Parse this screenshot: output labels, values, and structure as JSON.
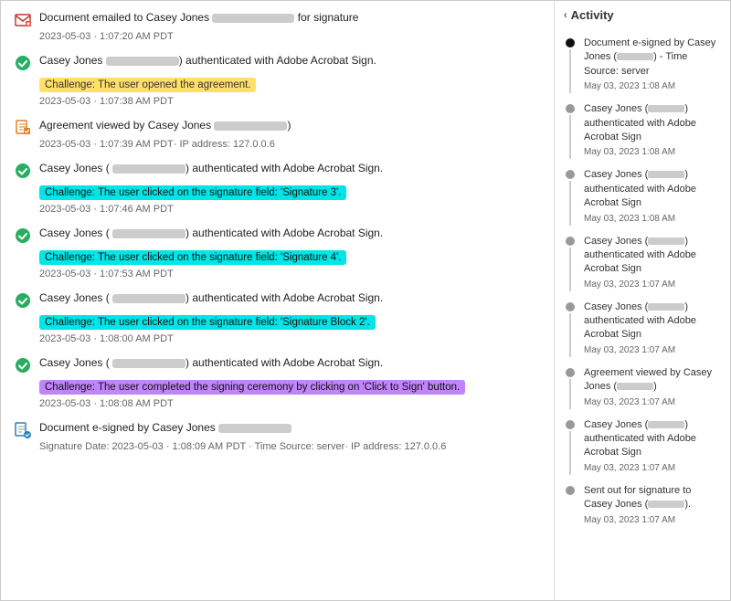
{
  "leftPanel": {
    "events": [
      {
        "id": "email-sent",
        "iconType": "email",
        "iconSymbol": "✉",
        "text": "Document emailed to Casey Jones",
        "blurWidth": "90px",
        "textSuffix": " for signature",
        "timestamp": "2023-05-03 · 1:07:20 AM PDT",
        "challenge": null
      },
      {
        "id": "auth-1",
        "iconType": "check",
        "iconSymbol": "✔",
        "text": "Casey Jones",
        "blurWidth": "80px",
        "textSuffix": ") authenticated with Adobe Acrobat Sign.",
        "timestamp": "2023-05-03 · 1:07:38 AM PDT",
        "challenge": "Challenge: The user opened the agreement.",
        "challengeColor": "badge-yellow"
      },
      {
        "id": "view-1",
        "iconType": "view",
        "iconSymbol": "📄",
        "text": "Agreement viewed by Casey Jones",
        "blurWidth": "80px",
        "textSuffix": ")",
        "timestamp": "2023-05-03 · 1:07:39 AM PDT· IP address: 127.0.0.6",
        "challenge": null
      },
      {
        "id": "auth-2",
        "iconType": "check",
        "iconSymbol": "✔",
        "text": "Casey Jones (",
        "blurWidth": "80px",
        "textSuffix": ") authenticated with Adobe Acrobat Sign.",
        "timestamp": "2023-05-03 · 1:07:46 AM PDT",
        "challenge": "Challenge: The user clicked on the signature field: 'Signature 3'.",
        "challengeColor": "badge-cyan"
      },
      {
        "id": "auth-3",
        "iconType": "check",
        "iconSymbol": "✔",
        "text": "Casey Jones (",
        "blurWidth": "80px",
        "textSuffix": ") authenticated with Adobe Acrobat Sign.",
        "timestamp": "2023-05-03 · 1:07:53 AM PDT",
        "challenge": "Challenge: The user clicked on the signature field: 'Signature 4'.",
        "challengeColor": "badge-cyan"
      },
      {
        "id": "auth-4",
        "iconType": "check",
        "iconSymbol": "✔",
        "text": "Casey Jones (",
        "blurWidth": "80px",
        "textSuffix": ") authenticated with Adobe Acrobat Sign.",
        "timestamp": "2023-05-03 · 1:08:00 AM PDT",
        "challenge": "Challenge: The user clicked on the signature field: 'Signature Block 2'.",
        "challengeColor": "badge-cyan"
      },
      {
        "id": "auth-5",
        "iconType": "check",
        "iconSymbol": "✔",
        "text": "Casey Jones (",
        "blurWidth": "80px",
        "textSuffix": ") authenticated with Adobe Acrobat Sign.",
        "timestamp": "2023-05-03 · 1:08:08 AM PDT",
        "challenge": "Challenge: The user completed the signing ceremony by clicking on 'Click to Sign' button.",
        "challengeColor": "badge-purple"
      },
      {
        "id": "esigned",
        "iconType": "signed",
        "iconSymbol": "✍",
        "text": "Document e-signed by Casey Jones",
        "blurWidth": "80px",
        "textSuffix": "",
        "timestamp": "Signature Date: 2023-05-03 · 1:08:09 AM PDT · Time Source: server· IP address: 127.0.0.6",
        "challenge": null
      }
    ]
  },
  "rightPanel": {
    "title": "Activity",
    "items": [
      {
        "dotColor": "black",
        "text": "Document e-signed by Casey Jones (",
        "blurWidth": "40px",
        "textSuffix": ") - Time Source: server",
        "date": "May 03, 2023 1:08 AM"
      },
      {
        "dotColor": "gray",
        "text": "Casey Jones (",
        "blurWidth": "40px",
        "textSuffix": ") authenticated with Adobe Acrobat Sign",
        "date": "May 03, 2023 1:08 AM"
      },
      {
        "dotColor": "gray",
        "text": "Casey Jones (",
        "blurWidth": "40px",
        "textSuffix": ") authenticated with Adobe Acrobat Sign",
        "date": "May 03, 2023 1:08 AM"
      },
      {
        "dotColor": "gray",
        "text": "Casey Jones (",
        "blurWidth": "40px",
        "textSuffix": ") authenticated with Adobe Acrobat Sign",
        "date": "May 03, 2023 1:07 AM"
      },
      {
        "dotColor": "gray",
        "text": "Casey Jones (",
        "blurWidth": "40px",
        "textSuffix": ") authenticated with Adobe Acrobat Sign",
        "date": "May 03, 2023 1:07 AM"
      },
      {
        "dotColor": "gray",
        "text": "Agreement viewed by Casey Jones (",
        "blurWidth": "40px",
        "textSuffix": ")",
        "date": "May 03, 2023 1:07 AM"
      },
      {
        "dotColor": "gray",
        "text": "Casey Jones (",
        "blurWidth": "40px",
        "textSuffix": ") authenticated with Adobe Acrobat Sign",
        "date": "May 03, 2023 1:07 AM"
      },
      {
        "dotColor": "gray",
        "text": "Sent out for signature to Casey Jones (",
        "blurWidth": "40px",
        "textSuffix": ").",
        "date": "May 03, 2023 1:07 AM"
      }
    ]
  }
}
